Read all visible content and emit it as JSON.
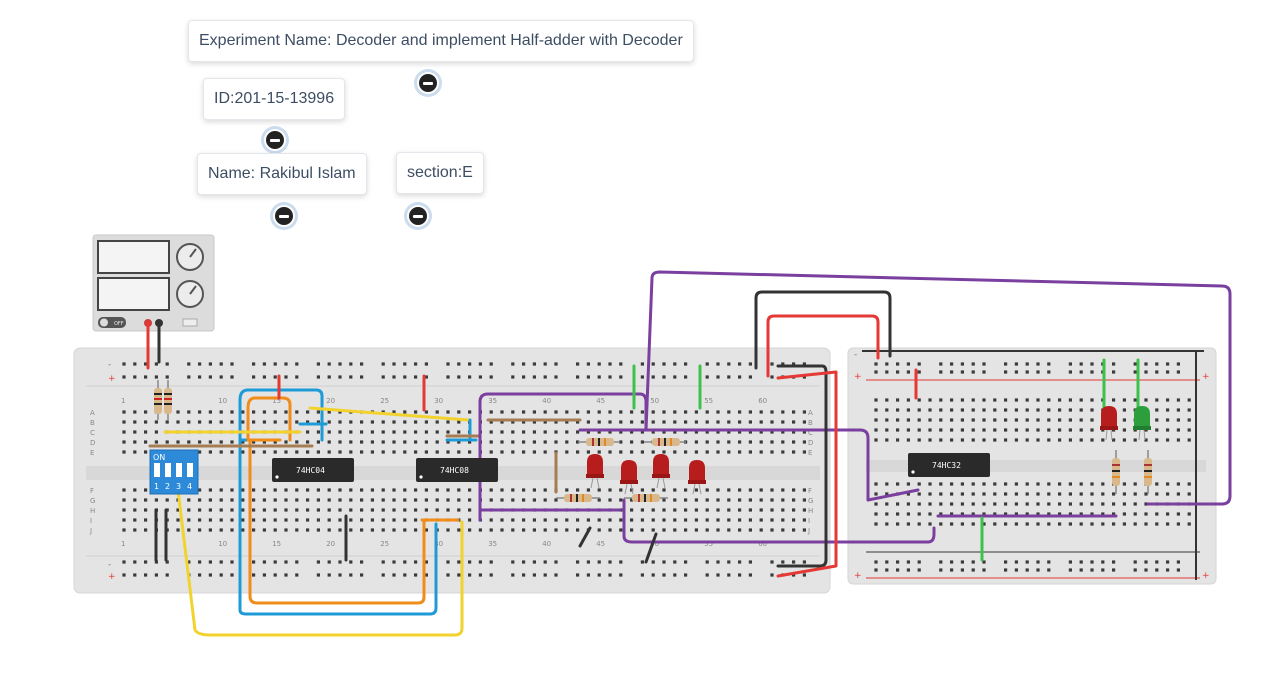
{
  "notes": {
    "experiment": "Experiment Name: Decoder and implement Half-adder with Decoder",
    "id": "ID:201-15-13996",
    "name": "Name: Rakibul Islam",
    "section": "section:E"
  },
  "chips": {
    "chip1": "74HC04",
    "chip2": "74HC08",
    "chip3": "74HC32"
  },
  "dip_switch": {
    "on_label": "ON",
    "numbers": [
      "1",
      "2",
      "3",
      "4"
    ]
  },
  "power_supply": {
    "off_label": "OFF"
  },
  "breadboard_main": {
    "column_numbers": [
      "1",
      "10",
      "15",
      "20",
      "25",
      "30",
      "35",
      "40",
      "45",
      "50",
      "55",
      "60"
    ],
    "row_letters_top": [
      "A",
      "B",
      "C",
      "D",
      "E"
    ],
    "row_letters_bottom": [
      "F",
      "G",
      "H",
      "I",
      "J"
    ]
  },
  "colors": {
    "wire_red": "#e53935",
    "wire_black": "#333333",
    "wire_blue": "#1e9bd7",
    "wire_orange": "#f08c1a",
    "wire_yellow": "#f2d22c",
    "wire_purple": "#7b3fa0",
    "wire_green": "#3cc14a",
    "wire_brown": "#a67c52",
    "led_red": "#b81d1d",
    "led_green": "#2c9f3c",
    "dip_blue": "#2c8ad8"
  }
}
